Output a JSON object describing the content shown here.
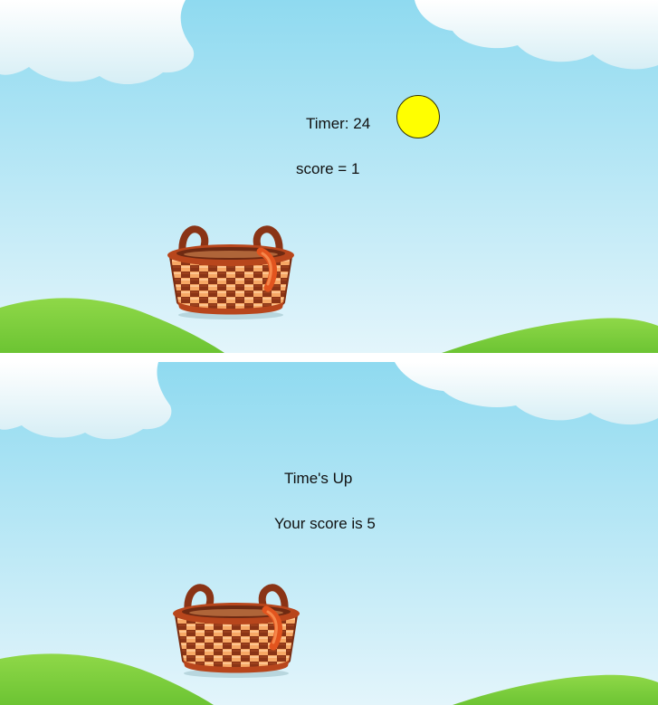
{
  "colors": {
    "sky_top": "#91dcf0",
    "sky_bottom": "#dff4fb",
    "cloud": "#ffffff",
    "cloud_shadow": "#cfeaf2",
    "hill": "#7fcf3a",
    "hill_light": "#9bdc50",
    "sun_fill": "#ffff00",
    "basket_dark": "#8a3416",
    "basket_light": "#f7a865",
    "basket_rim": "#b8461c",
    "strap": "#e2541e"
  },
  "playing": {
    "timer_text": "Timer: 24",
    "score_text": "score = 1"
  },
  "game_over": {
    "times_up_text": "Time's Up",
    "final_score_text": "Your score is 5"
  },
  "icons": {
    "sun": "sun-icon",
    "basket": "basket-icon",
    "cloud": "cloud-icon",
    "hill": "hill-icon"
  }
}
